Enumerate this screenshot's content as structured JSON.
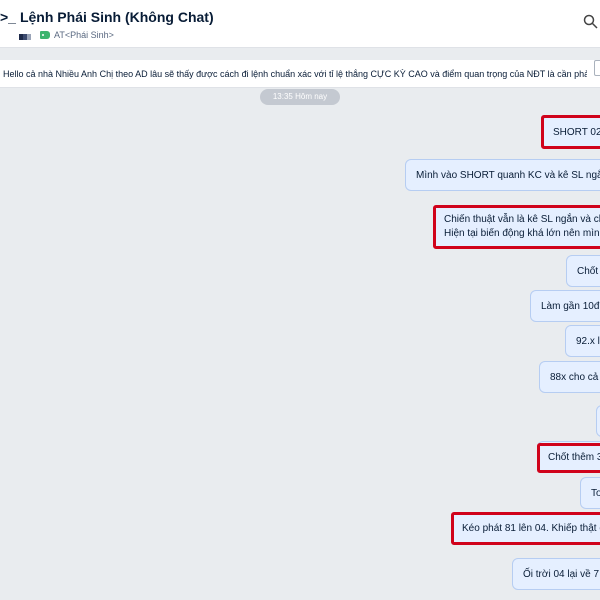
{
  "header": {
    "prompt": ">_",
    "title": "Lệnh Phái Sinh (Không Chat)",
    "tag_label": "AT<Phái Sinh>",
    "icon": "search-icon"
  },
  "pinned": {
    "text": "Hello cả nhà Nhiều Anh Chị theo AD lâu sẽ thấy được cách đi lệnh chuẩn xác với tỉ lệ thắng CỰC KỲ CAO và điểm quan trọng của NĐT là cần phải ..."
  },
  "time_chip": "13:35 Hôm nay",
  "messages": [
    {
      "lines": [
        "SHORT 02-"
      ],
      "highlight": true
    },
    {
      "lines": [
        "Mình vào SHORT quanh KC và kê SL ngắn"
      ],
      "highlight": false
    },
    {
      "lines": [
        "Chiến thuật vẫn là kê SL ngắn và ch",
        "Hiện tại biến động khá lớn nên mìn"
      ],
      "highlight": true
    },
    {
      "lines": [
        "Chốt"
      ],
      "highlight": false
    },
    {
      "lines": [
        "Làm gần 10đ n"
      ],
      "highlight": false
    },
    {
      "lines": [
        "92.x lu"
      ],
      "highlight": false
    },
    {
      "lines": [
        "88x cho cả"
      ],
      "highlight": false
    },
    {
      "lines": [
        ""
      ],
      "highlight": false
    },
    {
      "lines": [
        "Chốt thêm 3"
      ],
      "highlight": true
    },
    {
      "lines": [
        "To"
      ],
      "highlight": false
    },
    {
      "lines": [
        "Kéo phát 81 lên 04. Khiếp thật c"
      ],
      "highlight": true
    },
    {
      "lines": [
        "Ối trời 04 lại về 7"
      ],
      "highlight": false
    }
  ],
  "colors": {
    "bubble_bg": "#e5efff",
    "highlight": "#d0021b",
    "tag": "#3cb46e"
  }
}
